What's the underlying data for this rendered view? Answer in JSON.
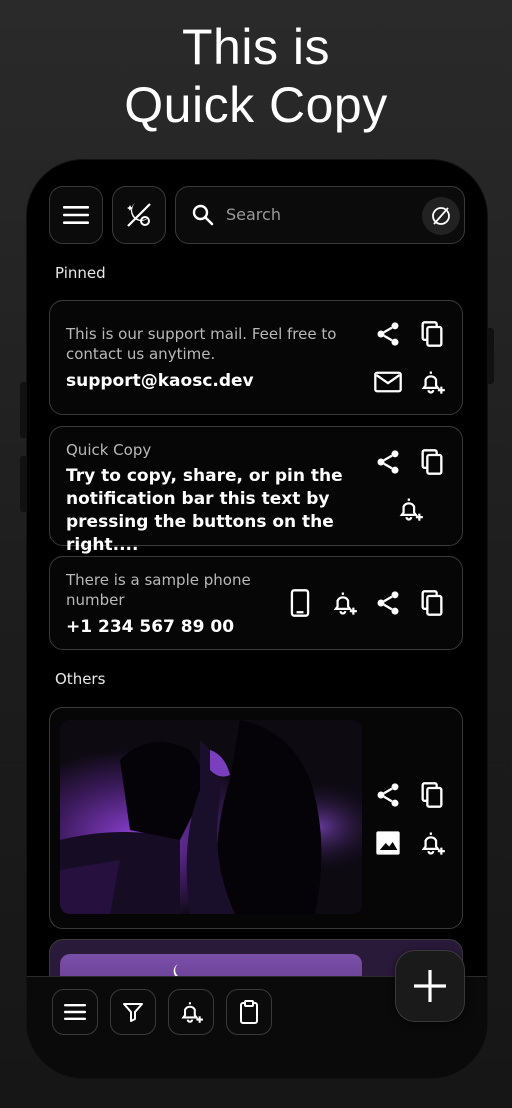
{
  "headline": {
    "line1": "This is",
    "line2": "Quick Copy"
  },
  "top_bar": {
    "search_placeholder": "Search"
  },
  "sections": {
    "pinned": "Pinned",
    "others": "Others"
  },
  "cards": [
    {
      "subtitle": "This is our support mail. Feel free to contact us anytime.",
      "content": "support@kaosc.dev",
      "type": "email"
    },
    {
      "subtitle": "Quick Copy",
      "content": "Try to copy, share, or pin the notification bar this text by pressing the buttons on the right....",
      "type": "text"
    },
    {
      "subtitle": "There is a sample phone number",
      "content": "+1 234 567 89 00",
      "type": "phone"
    },
    {
      "subtitle": "",
      "content": "",
      "type": "image"
    }
  ],
  "colors": {
    "background": "#1c1c1c",
    "phone": "#000000",
    "border": "#3a3a3a",
    "text_secondary": "#b8b8b8",
    "accent_purple": "#7b3fb0"
  }
}
